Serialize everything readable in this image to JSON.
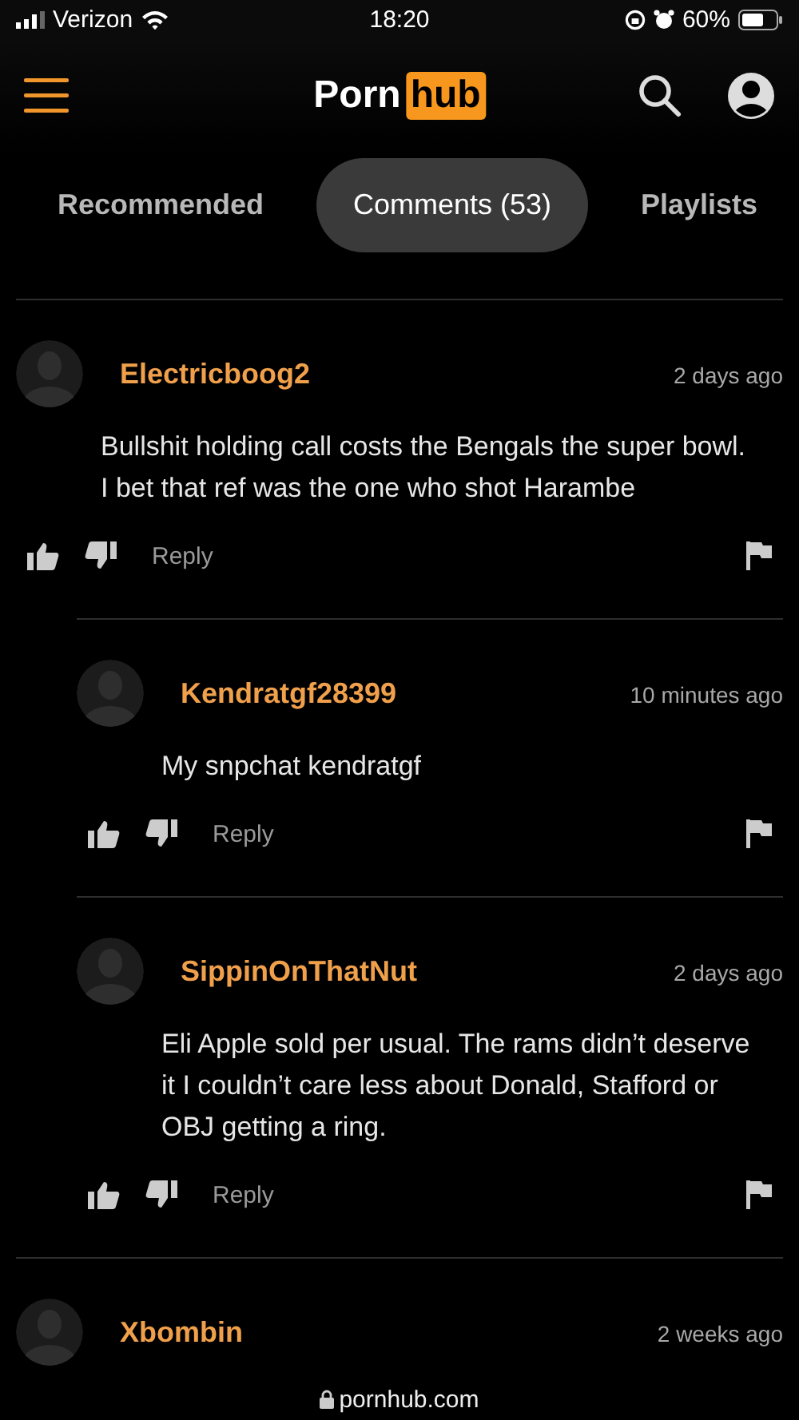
{
  "status_bar": {
    "carrier": "Verizon",
    "time": "18:20",
    "battery": "60%"
  },
  "header": {
    "logo_left": "Porn",
    "logo_right": "hub"
  },
  "tabs": [
    {
      "label": "Recommended",
      "selected": false
    },
    {
      "label": "Comments (53)",
      "selected": true
    },
    {
      "label": "Playlists",
      "selected": false
    }
  ],
  "comments": [
    {
      "user": "Electricboog2",
      "time": "2 days ago",
      "text": "Bullshit holding call costs the Bengals the super bowl. I bet that ref was the one who shot Harambe",
      "reply": "Reply",
      "children": [
        {
          "user": "Kendratgf28399",
          "time": "10 minutes ago",
          "text": "My snpchat kendratgf",
          "reply": "Reply"
        },
        {
          "user": "SippinOnThatNut",
          "time": "2 days ago",
          "text": "Eli Apple sold per usual. The rams didn’t deserve it I couldn’t care less about Donald, Stafford or OBJ getting a ring.",
          "reply": "Reply"
        }
      ]
    },
    {
      "user": "Xbombin",
      "time": "2 weeks ago"
    }
  ],
  "url_bar": {
    "domain": "pornhub.com"
  }
}
